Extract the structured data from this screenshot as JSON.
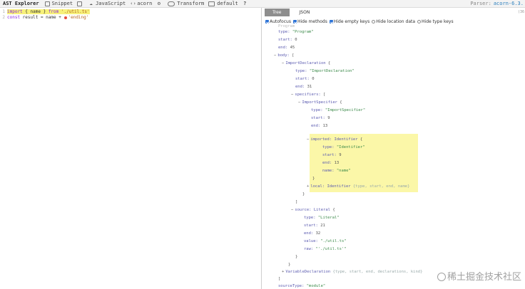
{
  "toolbar": {
    "title": "AST Explorer",
    "items": [
      {
        "label": "Snippet",
        "icon": "snippet-icon"
      },
      {
        "label": "",
        "icon": "save-icon"
      },
      {
        "label": "JavaScript",
        "icon": "cloud-icon"
      },
      {
        "label": "acorn",
        "icon": "code-icon"
      },
      {
        "label": "",
        "icon": "gear-icon"
      },
      {
        "label": "Transform",
        "icon": "toggle-icon"
      },
      {
        "label": "default",
        "icon": "keyboard-icon"
      },
      {
        "label": "",
        "icon": "help-icon"
      }
    ],
    "parser_label": "Parser:",
    "parser_value": "acorn-6.3."
  },
  "editor": {
    "lines": [
      {
        "n": "1",
        "t1": "import",
        "t2": " { name } ",
        "t3": "from",
        "t4": " './util.ts'"
      },
      {
        "n": "2",
        "t1": "const",
        "t2": " result = name + ",
        "t3": "'ending'"
      }
    ]
  },
  "output": {
    "tabs": [
      "Tree",
      "JSON"
    ],
    "active_tab": "Tree",
    "count": "(36",
    "options": [
      {
        "label": "Autofocus",
        "checked": true,
        "round": false
      },
      {
        "label": "Hide methods",
        "checked": true,
        "round": false
      },
      {
        "label": "Hide empty keys",
        "checked": true,
        "round": false
      },
      {
        "label": "Hide location data",
        "checked": false,
        "round": true
      },
      {
        "label": "Hide type keys",
        "checked": false,
        "round": true
      }
    ],
    "tree": {
      "l0": "Program",
      "l1k": "type:",
      "l1v": "\"Program\"",
      "l2k": "start:",
      "l2v": "0",
      "l3k": "end:",
      "l3v": "45",
      "l4k": "body:",
      "l4v": "[",
      "l5k": "ImportDeclaration",
      "l5v": "{",
      "l6k": "type:",
      "l6v": "\"ImportDeclaration\"",
      "l7k": "start:",
      "l7v": "0",
      "l8k": "end:",
      "l8v": "31",
      "l9k": "specifiers:",
      "l9v": "[",
      "l10k": "ImportSpecifier",
      "l10v": "{",
      "l11k": "type:",
      "l11v": "\"ImportSpecifier\"",
      "l12k": "start:",
      "l12v": "9",
      "l13k": "end:",
      "l13v": "13",
      "l14k": "imported:",
      "l14t": "Identifier",
      "l14v": "{",
      "l15k": "type:",
      "l15v": "\"Identifier\"",
      "l16k": "start:",
      "l16v": "9",
      "l17k": "end:",
      "l17v": "13",
      "l18k": "name:",
      "l18v": "\"name\"",
      "l19": "}",
      "l20k": "local:",
      "l20t": "Identifier",
      "l20v": "{type, start, end, name}",
      "l21": "}",
      "l22": "]",
      "l23k": "source:",
      "l23t": "Literal",
      "l23v": "{",
      "l24k": "type:",
      "l24v": "\"Literal\"",
      "l25k": "start:",
      "l25v": "21",
      "l26k": "end:",
      "l26v": "32",
      "l27k": "value:",
      "l27v": "\"./util.ts\"",
      "l28k": "raw:",
      "l28v": "\"'./util.ts'\"",
      "l29": "}",
      "l30": "}",
      "l31k": "VariableDeclaration",
      "l31v": "{type, start, end, declarations, kind}",
      "l32": "]",
      "l33k": "sourceType:",
      "l33v": "\"module\"",
      "l34": "}"
    }
  },
  "watermark": "稀土掘金技术社区"
}
